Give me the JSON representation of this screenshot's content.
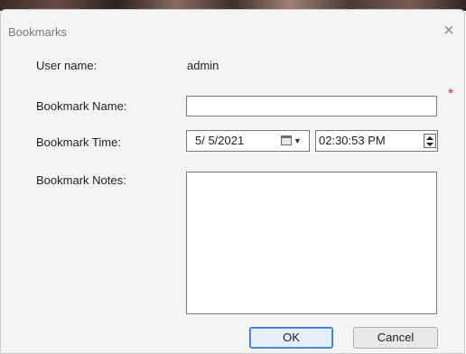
{
  "window": {
    "title": "Bookmarks",
    "close_icon": "×"
  },
  "fields": {
    "user_name": {
      "label": "User name:",
      "value": "admin"
    },
    "bookmark_name": {
      "label": "Bookmark Name:",
      "value": "",
      "required_marker": "*"
    },
    "bookmark_time": {
      "label": "Bookmark Time:",
      "date": "5/ 5/2021",
      "time": "02:30:53 PM",
      "dropdown_arrow": "▼"
    },
    "bookmark_notes": {
      "label": "Bookmark Notes:",
      "value": ""
    }
  },
  "buttons": {
    "ok": "OK",
    "cancel": "Cancel"
  },
  "colors": {
    "required": "#e03030",
    "dialog_bg": "#f4f4f4",
    "default_button_border": "#2f6fca"
  }
}
